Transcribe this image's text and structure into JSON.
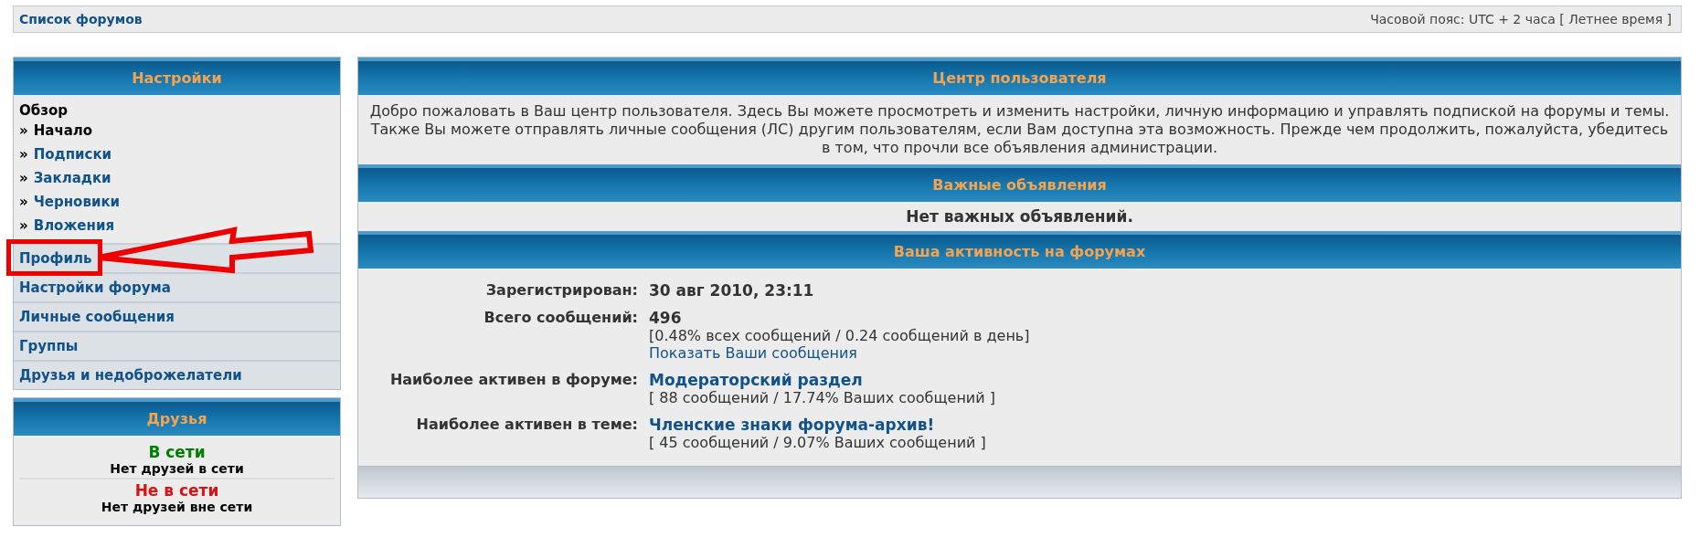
{
  "top_bar": {
    "breadcrumb": "Список форумов",
    "timezone": "Часовой пояс: UTC + 2 часа [ Летнее время ]"
  },
  "settings_panel": {
    "title": "Настройки",
    "section": "Обзор",
    "sub_items": [
      {
        "marker": "»",
        "label": "Начало",
        "selected": true
      },
      {
        "marker": "»",
        "label": "Подписки",
        "selected": false
      },
      {
        "marker": "»",
        "label": "Закладки",
        "selected": false
      },
      {
        "marker": "»",
        "label": "Черновики",
        "selected": false
      },
      {
        "marker": "»",
        "label": "Вложения",
        "selected": false
      }
    ],
    "sections": [
      "Профиль",
      "Настройки форума",
      "Личные сообщения",
      "Группы",
      "Друзья и недоброжелатели"
    ]
  },
  "friends_panel": {
    "title": "Друзья",
    "groups": [
      {
        "heading": "В сети",
        "color": "#008000",
        "text": "Нет друзей в сети"
      },
      {
        "heading": "Не в сети",
        "color": "#dd1111",
        "text": "Нет друзей вне сети"
      }
    ]
  },
  "main": {
    "title": "Центр пользователя",
    "intro": "Добро пожаловать в Ваш центр пользователя. Здесь Вы можете просмотреть и изменить настройки, личную информацию и управлять подпиской на форумы и темы. Также Вы можете отправлять личные сообщения (ЛС) другим пользователям, если Вам доступна эта возможность. Прежде чем продолжить, пожалуйста, убедитесь в том, что прочли все объявления администрации.",
    "announcements_title": "Важные объявления",
    "announcements_text": "Нет важных объявлений.",
    "activity_title": "Ваша активность на форумах",
    "stats": [
      {
        "label": "Зарегистрирован:",
        "value": "30 авг 2010, 23:11",
        "kind": "text"
      },
      {
        "label": "Всего сообщений:",
        "value": "496",
        "kind": "text",
        "details": [
          "[0.48% всех сообщений / 0.24 сообщений в день]"
        ],
        "link": "Показать Ваши сообщения"
      },
      {
        "label": "Наиболее активен в форуме:",
        "value": "Модераторский раздел",
        "kind": "link",
        "details": [
          "[ 88 сообщений / 17.74% Ваших сообщений ]"
        ]
      },
      {
        "label": "Наиболее активен в теме:",
        "value": "Членские знаки форума-архив!",
        "kind": "link",
        "details": [
          "[ 45 сообщений / 9.07% Ваших сообщений ]"
        ]
      }
    ]
  }
}
